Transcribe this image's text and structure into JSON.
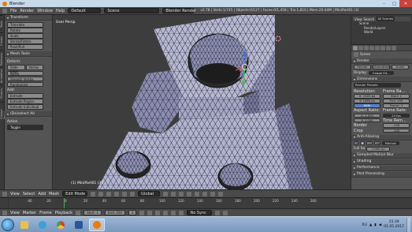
{
  "window": {
    "title": "Blender",
    "controls": [
      "–",
      "□",
      "✕"
    ]
  },
  "info_header": {
    "menus": [
      "File",
      "Render",
      "Window",
      "Help"
    ],
    "layout": "Default",
    "scene": "Scene",
    "engine": "Blender Render",
    "stats": "v2.78 | Verts:1/745 | Objects:0/127 | Faces:0/1,458 | Tris:1,810 | Mem:20.04M | MiniPart01 (3)"
  },
  "left_tabs": [
    "Tools",
    "Create",
    "Relations",
    "Animation",
    "Physics",
    "Grease Pencil"
  ],
  "tool_shelf": {
    "transform": {
      "title": "Transform",
      "buttons": [
        "Translate",
        "Rotate",
        "Scale",
        "Shrink/Fatten",
        "Push/Pull"
      ]
    },
    "mesh_tools": {
      "title": "Mesh Tools",
      "deform_label": "Deform:",
      "deform_buttons": [
        "Slide Edge",
        "Vertex"
      ],
      "deform_more": [
        "Noise",
        "Smooth Vertex",
        "Randomize"
      ],
      "add_label": "Add:",
      "add_buttons": [
        "Extrude",
        "Extrude Region",
        "Extrude Individual"
      ]
    },
    "operator": {
      "title": "(De)select All",
      "action_label": "Action",
      "action_value": "Toggle"
    }
  },
  "viewport": {
    "label": "User Persp",
    "object_label": "(1) MiniPart01 (3)",
    "colors": {
      "mesh_light": "#b9bad6",
      "mesh_mid": "#9a9cc2",
      "mesh_dark": "#6f7196",
      "wire": "#161616",
      "bg": "#3d3d3d"
    }
  },
  "outliner": {
    "view": "View",
    "search": "Search",
    "filter": "All Scenes",
    "items": [
      "Scene",
      "RenderLayers",
      "World"
    ]
  },
  "properties": {
    "scene_label": "Scene",
    "render_title": "Render",
    "render_buttons": [
      "Render",
      "Animation",
      "Audio"
    ],
    "display_label": "Display:",
    "display_value": "Image Ed...",
    "dimensions_title": "Dimensions",
    "presets_label": "Render Presets",
    "resolution_label": "Resolution:",
    "frame_range_label": "Frame Ra...",
    "res_x": "X: 1920 px",
    "res_y": "Y: 1080 px",
    "res_pct": "50%",
    "start": "Start: 1",
    "end": "End: 250",
    "frame_step": "Frame: 1",
    "aspect_label": "Aspect Ratio:",
    "frame_rate_label": "Frame Rate:",
    "aspect_x": "X: 1.000",
    "aspect_y": "Y: 1.000",
    "fps": "24 fps",
    "time_remap_label": "Time Rem...",
    "border_label": "Border",
    "crop_label": "Crop",
    "old": "-100",
    "new": "-100",
    "aa_title": "Anti-Aliasing",
    "aa_values": [
      "5",
      "8",
      "11",
      "16"
    ],
    "aa_filter": "Mitchell",
    "full_sample": "Full Sa",
    "filter_size": "1.000 px",
    "closed_panels": [
      "Sampled Motion Blur",
      "Shading",
      "Performance",
      "Post Processing"
    ]
  },
  "viewport_header": {
    "menus": [
      "View",
      "Select",
      "Add",
      "Mesh"
    ],
    "mode": "Edit Mode",
    "pivot": "Global"
  },
  "timeline": {
    "ticks": [
      "-40",
      "-20",
      "0",
      "20",
      "40",
      "60",
      "80",
      "100",
      "120",
      "140",
      "160",
      "180",
      "200",
      "220",
      "240",
      "260"
    ],
    "current_frame": 1
  },
  "timeline_header": {
    "menus": [
      "View",
      "Marker",
      "Frame",
      "Playback"
    ],
    "start": "Start:",
    "start_value": "1",
    "end": "End:",
    "end_value": "250",
    "current": "1",
    "sync": "No Sync"
  },
  "taskbar": {
    "lang": "RU",
    "time": "15:39",
    "date": "01.05.2017"
  }
}
